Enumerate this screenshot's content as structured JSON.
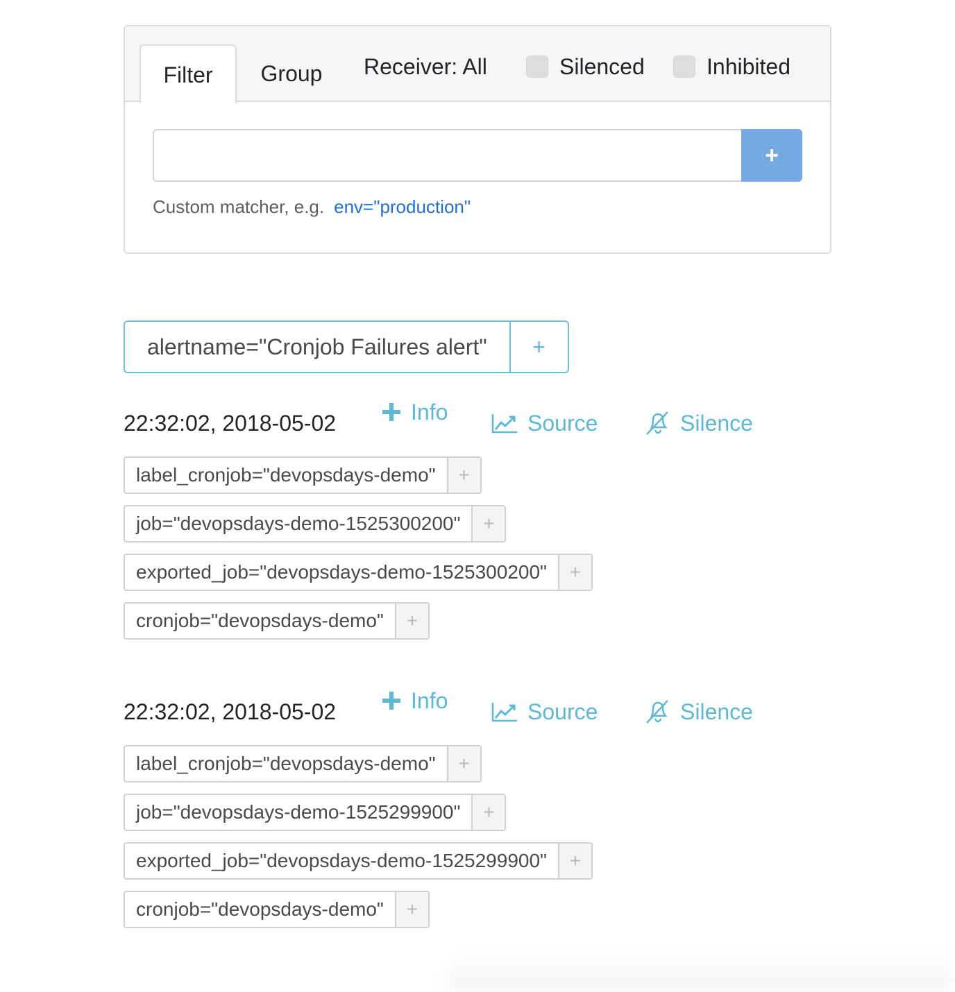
{
  "filter_panel": {
    "tabs": [
      {
        "label": "Filter",
        "active": true
      },
      {
        "label": "Group",
        "active": false
      }
    ],
    "receiver_label": "Receiver: All",
    "checkboxes": [
      {
        "label": "Silenced",
        "checked": false
      },
      {
        "label": "Inhibited",
        "checked": false
      }
    ],
    "matcher_input_value": "",
    "add_button_label": "+",
    "hint_text": "Custom matcher, e.g.",
    "hint_example": "env=\"production\""
  },
  "group": {
    "label": "alertname=\"Cronjob Failures alert\"",
    "add_label": "+"
  },
  "alerts": [
    {
      "time": "22:32:02, 2018-05-02",
      "actions": {
        "info": "Info",
        "source": "Source",
        "silence": "Silence"
      },
      "labels": [
        "label_cronjob=\"devopsdays-demo\"",
        "job=\"devopsdays-demo-1525300200\"",
        "exported_job=\"devopsdays-demo-1525300200\"",
        "cronjob=\"devopsdays-demo\""
      ]
    },
    {
      "time": "22:32:02, 2018-05-02",
      "actions": {
        "info": "Info",
        "source": "Source",
        "silence": "Silence"
      },
      "labels": [
        "label_cronjob=\"devopsdays-demo\"",
        "job=\"devopsdays-demo-1525299900\"",
        "exported_job=\"devopsdays-demo-1525299900\"",
        "cronjob=\"devopsdays-demo\""
      ]
    }
  ],
  "label_add_symbol": "+",
  "colors": {
    "accent": "#5bb8d6",
    "button_blue": "#74a9e2",
    "link_blue": "#1f6fd6"
  },
  "icons": {
    "info": "plus-icon",
    "source": "line-chart-icon",
    "silence": "bell-slash-icon"
  }
}
